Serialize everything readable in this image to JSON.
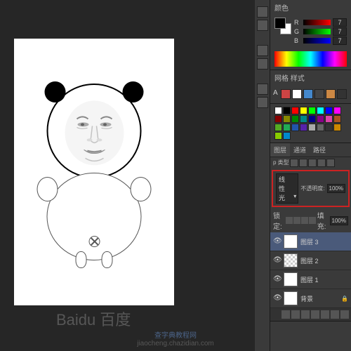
{
  "panels": {
    "color": {
      "title": "颜色",
      "channels": [
        {
          "label": "R",
          "value": "7"
        },
        {
          "label": "G",
          "value": "7"
        },
        {
          "label": "B",
          "value": "7"
        }
      ]
    },
    "styles": {
      "title": "样式",
      "tab2": "网格"
    },
    "swatches": {
      "colors": [
        "#fff",
        "#000",
        "#f00",
        "#ff0",
        "#0f0",
        "#0ff",
        "#00f",
        "#f0f",
        "#800",
        "#880",
        "#080",
        "#088",
        "#008",
        "#808",
        "#d4a",
        "#a52",
        "#5a2",
        "#2a5",
        "#25a",
        "#52a",
        "#aaa",
        "#666",
        "#333",
        "#c80",
        "#8c0",
        "#08c"
      ]
    },
    "layers": {
      "tabs": [
        "图层",
        "通道",
        "路径"
      ],
      "kind_label": "p 类型",
      "blend_mode": "线性光",
      "opacity_label": "不透明度:",
      "opacity_value": "100%",
      "lock_label": "锁定:",
      "fill_label": "填充:",
      "fill_value": "100%",
      "items": [
        {
          "name": "图层 3",
          "visible": true,
          "active": true,
          "thumb": "face"
        },
        {
          "name": "图层 2",
          "visible": true,
          "thumb": "checker"
        },
        {
          "name": "图层 1",
          "visible": true,
          "thumb": "panda"
        },
        {
          "name": "背景",
          "visible": true,
          "locked": true,
          "thumb": "white"
        }
      ]
    }
  },
  "watermark": {
    "main": "查字典教程网",
    "sub": "jiaocheng.chazidian.com",
    "baidu": "Baidu 百度"
  }
}
